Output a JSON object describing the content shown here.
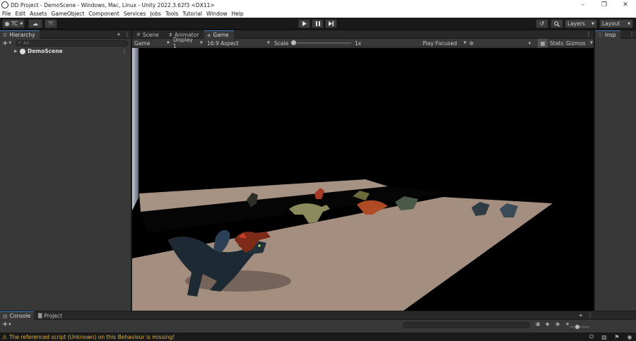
{
  "window": {
    "title": "DD Project - DemoScene - Windows, Mac, Linux - Unity 2022.3.62f3 <DX11>",
    "minimize": "–",
    "maximize": "❐",
    "close": "✕"
  },
  "menu": [
    "File",
    "Edit",
    "Assets",
    "GameObject",
    "Component",
    "Services",
    "Jobs",
    "Tools",
    "Tutorial",
    "Window",
    "Help"
  ],
  "toolbar": {
    "account": "TC",
    "layers": "Layers",
    "layout": "Layout"
  },
  "hierarchy": {
    "tab": "Hierarchy",
    "search_placeholder": "All",
    "scene": "DemoScene"
  },
  "center_tabs": [
    {
      "label": "Scene",
      "icon": "grid-icon"
    },
    {
      "label": "Animator",
      "icon": "animator-icon"
    },
    {
      "label": "Game",
      "icon": "gamepad-icon"
    }
  ],
  "game_toolbar": {
    "mode": "Game",
    "display": "Display 1",
    "aspect": "16:9 Aspect",
    "scale_label": "Scale",
    "scale_value": "1x",
    "scale_fraction": 0,
    "play_mode": "Play Focused",
    "stats": "Stats",
    "gizmos": "Gizmos"
  },
  "inspector": {
    "tab": "Insp"
  },
  "bottom_tabs": [
    {
      "label": "Console",
      "icon": "console-icon"
    },
    {
      "label": "Project",
      "icon": "folder-icon"
    }
  ],
  "status": {
    "message": "The referenced script (Unknown) on this Behaviour is missing!",
    "color": "#e3b53b"
  },
  "colors": {
    "accent": "#3a79bb",
    "panel": "#383838",
    "floor": "#a48e7f"
  }
}
